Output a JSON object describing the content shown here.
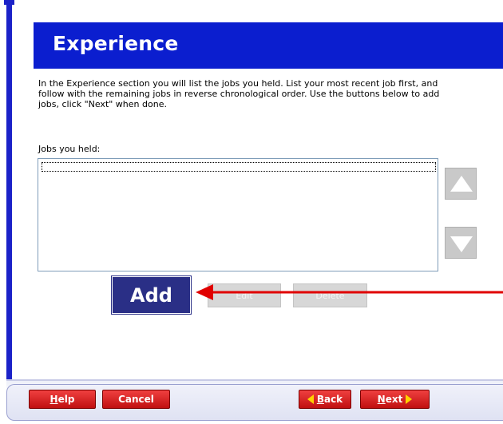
{
  "header": {
    "title": "Experience"
  },
  "intro": {
    "line1": "In the Experience section you will list the jobs you held.  List your most recent job first, and",
    "line2": "follow with the remaining jobs in reverse chronological order.  Use the buttons below to add",
    "line3": "jobs, click \"Next\" when done."
  },
  "jobs_list": {
    "label_mnemonic": "J",
    "label_rest": "obs you held:",
    "items": []
  },
  "buttons": {
    "add": "Add",
    "edit": "Edit",
    "delete": "Delete",
    "move_up_icon": "arrow-up-icon",
    "move_down_icon": "arrow-down-icon"
  },
  "footer": {
    "help_mnemonic": "H",
    "help_rest": "elp",
    "cancel": "Cancel",
    "back_mnemonic": "B",
    "back_rest": "ack",
    "next_mnemonic": "N",
    "next_rest": "ext"
  },
  "colors": {
    "header_bg": "#0b1ecf",
    "add_button_bg": "#2a2f86",
    "pointer_arrow": "#e00000",
    "nav_button": "#d42020"
  }
}
